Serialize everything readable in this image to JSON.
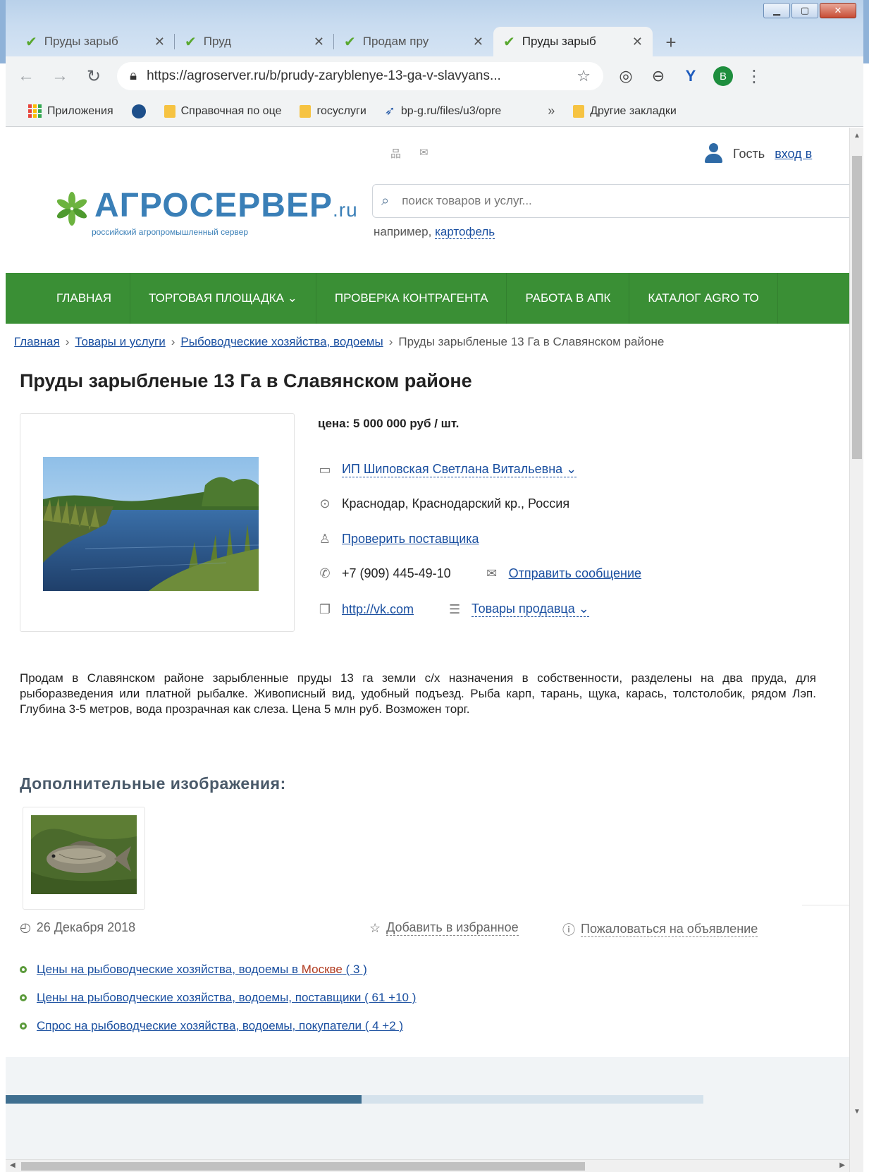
{
  "browser": {
    "tabs": [
      {
        "label": "Пруды зарыб"
      },
      {
        "label": "Пруд"
      },
      {
        "label": "Продам пру"
      },
      {
        "label": "Пруды зарыб"
      }
    ],
    "url": "https://agroserver.ru/b/prudy-zaryblenye-13-ga-v-slavyans...",
    "avatar_letter": "B",
    "bookmarks": {
      "apps": "Приложения",
      "spravochnaya": "Справочная по оце",
      "gosuslugi": "госуслуги",
      "bpg": "bp-g.ru/files/u3/opre",
      "more": "»",
      "other": "Другие закладки"
    }
  },
  "header": {
    "guest_label": "Гость",
    "login_link": "вход в",
    "logo_brand": "АГРОСЕРВЕР",
    "logo_tld": ".ru",
    "logo_slogan": "российский агропромышленный сервер",
    "search_placeholder": "поиск товаров и услуг...",
    "example_prefix": "например,",
    "example_link": "картофель"
  },
  "nav": [
    "ГЛАВНАЯ",
    "ТОРГОВАЯ ПЛОЩАДКА ⌄",
    "ПРОВЕРКА КОНТРАГЕНТА",
    "РАБОТА В АПК",
    "КАТАЛОГ AGRO ТО"
  ],
  "breadcrumbs": {
    "home": "Главная",
    "goods": "Товары и услуги",
    "category": "Рыбоводческие хозяйства, водоемы",
    "sep": "›",
    "current": "Пруды зарыбленые 13 Га в Славянском районе"
  },
  "listing": {
    "title": "Пруды зарыбленые 13 Га в Славянском районе",
    "price": "цена: 5 000 000 руб / шт.",
    "seller": "ИП Шиповская Светлана Витальевна ⌄",
    "location": "Краснодар, Краснодарский кр., Россия",
    "check_supplier": "Проверить поставщика",
    "phone": "+7 (909) 445-49-10",
    "send_message": "Отправить сообщение",
    "website": "http://vk.com",
    "seller_goods": "Товары продавца ⌄",
    "description": "Продам в Славянском районе зарыбленные пруды 13 га земли с/х назначения в собственности, разделены на два пруда, для рыборазведения или платной рыбалке. Живописный вид, удобный подъезд. Рыба карп, тарань, щука, карась, толстолобик, рядом Лэп. Глубина 3-5 метров, вода прозрачная как слеза. Цена 5 млн руб. Возможен торг.",
    "extra_images_heading": "Дополнительные изображения:",
    "date": "26 Декабря 2018",
    "add_favorite": "Добавить в избранное",
    "report": "Пожаловаться на объявление"
  },
  "related_links": [
    {
      "text": "Цены на рыбоводческие хозяйства, водоемы в ",
      "city": "Москве",
      "count": " ( 3 )"
    },
    {
      "text": "Цены на рыбоводческие хозяйства, водоемы, поставщики",
      "city": "",
      "count": " ( 61 +10 )"
    },
    {
      "text": "Спрос на рыбоводческие хозяйства, водоемы, покупатели",
      "city": "",
      "count": " ( 4 +2 )"
    }
  ],
  "colors": {
    "nav_green": "#3a8f35",
    "link_blue": "#1a4fa0",
    "brand_blue": "#3a7fb7",
    "city_red": "#b0391e"
  }
}
